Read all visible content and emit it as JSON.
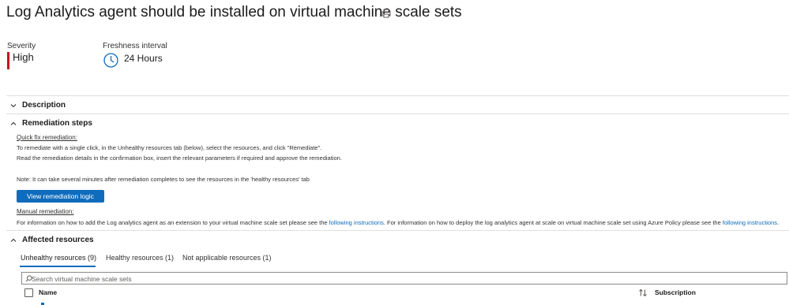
{
  "header": {
    "title": "Log Analytics agent should be installed on virtual machine scale sets",
    "print_icon": "print-icon"
  },
  "meta": {
    "severity_label": "Severity",
    "severity_value": "High",
    "severity_color": "#c50f1f",
    "freshness_label": "Freshness interval",
    "freshness_value": "24 Hours",
    "freshness_icon": "clock-icon"
  },
  "sections": {
    "description": {
      "label": "Description",
      "expanded": false
    },
    "remediation": {
      "label": "Remediation steps",
      "expanded": true,
      "quick_fix_heading": "Quick fix remediation:",
      "quick_fix_line1": "To remediate with a single click, in the Unhealthy resources tab (below), select the resources, and click \"Remediate\".",
      "quick_fix_line2": "Read the remediation details in the confirmation box, insert the relevant parameters if required and approve the remediation.",
      "note": "Note: It can take several minutes after remediation completes to see the resources in the 'healthy resources' tab",
      "button_label": "View remediation logic",
      "manual_heading": "Manual remediation:",
      "manual_text_a": "For information on how to add the Log analytics agent as an extension to your virtual machine scale set please see the ",
      "manual_link_a": "following instructions",
      "manual_text_b": ". For information on how to deploy the log analytics agent at scale on virtual machine scale set using Azure Policy please see the ",
      "manual_link_b": "following instructions",
      "manual_text_c": "."
    },
    "affected": {
      "label": "Affected resources",
      "expanded": true,
      "tabs": [
        {
          "label": "Unhealthy resources (9)",
          "active": true
        },
        {
          "label": "Healthy resources (1)",
          "active": false
        },
        {
          "label": "Not applicable resources (1)",
          "active": false
        }
      ],
      "search_placeholder": "Search virtual machine scale sets",
      "columns": {
        "name": "Name",
        "subscription": "Subscription"
      }
    }
  },
  "colors": {
    "accent": "#0f6cbd",
    "danger": "#c50f1f"
  }
}
